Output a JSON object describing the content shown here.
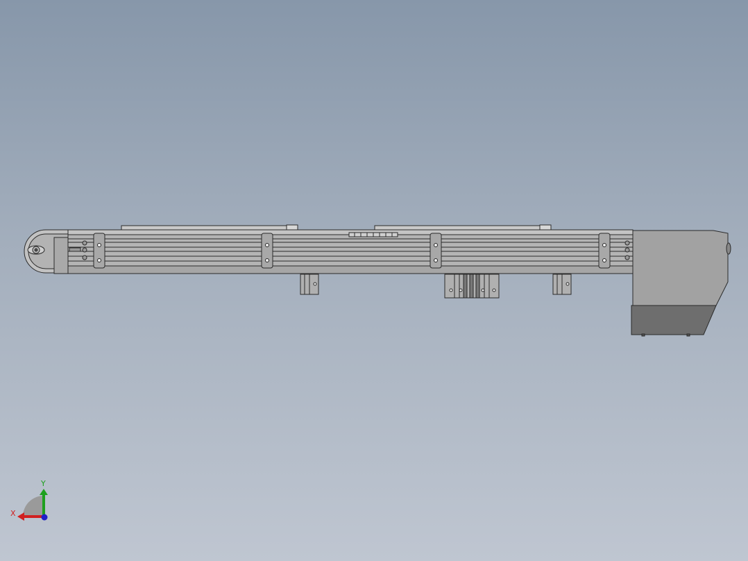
{
  "viewport": {
    "background_top": "#8797aa",
    "background_bottom": "#bfc6d1"
  },
  "model": {
    "name": "",
    "frame_color": "#b4b4b4",
    "line_color": "#2a2a2a",
    "motor_body_color": "#a2a2a2",
    "motor_base_color": "#6e6e6e"
  },
  "triad": {
    "x_label": "X",
    "y_label": "Y",
    "x_color": "#d02020",
    "y_color": "#1ea01e",
    "z_color": "#2020c8"
  }
}
